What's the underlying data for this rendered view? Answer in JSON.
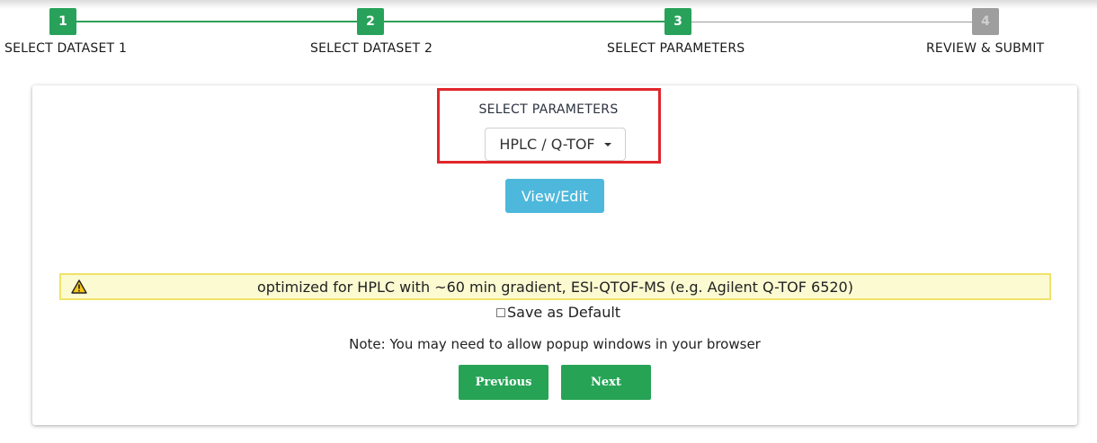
{
  "stepper": {
    "steps": [
      {
        "number": "1",
        "label": "SELECT DATASET 1",
        "state": "complete"
      },
      {
        "number": "2",
        "label": "SELECT DATASET 2",
        "state": "complete"
      },
      {
        "number": "3",
        "label": "SELECT PARAMETERS",
        "state": "current"
      },
      {
        "number": "4",
        "label": "REVIEW & SUBMIT",
        "state": "pending"
      }
    ]
  },
  "parameters": {
    "title": "SELECT PARAMETERS",
    "selected": "HPLC / Q-TOF",
    "view_edit_label": "View/Edit"
  },
  "warning": {
    "icon": "warning-triangle-icon",
    "text": "optimized for HPLC with ~60 min gradient, ESI-QTOF-MS (e.g. Agilent Q-TOF 6520)"
  },
  "save_default": {
    "label": "Save as Default",
    "checked": false
  },
  "note": "Note: You may need to allow popup windows in your browser",
  "navigation": {
    "previous_label": "Previous",
    "next_label": "Next"
  },
  "colors": {
    "step_active": "#28a25a",
    "step_inactive": "#9e9e9e",
    "highlight_border": "#e0262b",
    "view_edit_button": "#4db8dc",
    "warning_bg": "#fcfad1",
    "warning_border": "#f0e36a",
    "nav_button": "#27a356"
  }
}
